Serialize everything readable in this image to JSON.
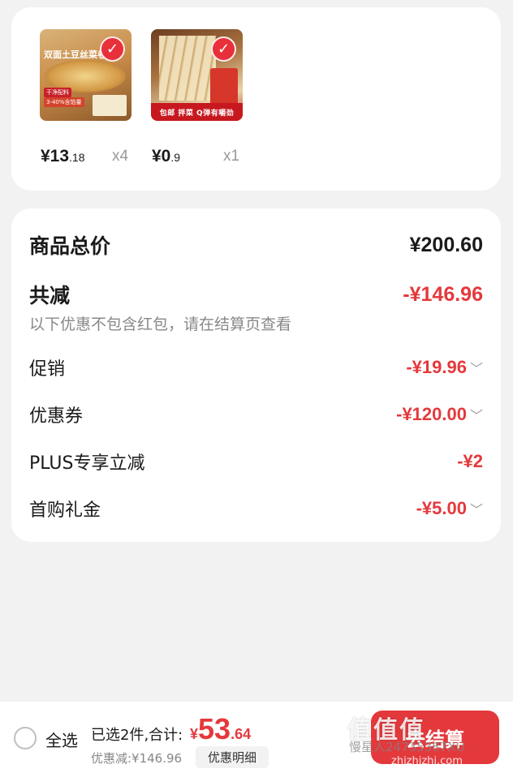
{
  "items": [
    {
      "image_title": "双面土豆丝菜卷",
      "image_tag1": "干净配料",
      "image_tag2": "3-40%含馅量",
      "price_int": "¥13",
      "price_dec": ".18",
      "qty": "x4",
      "checked": true
    },
    {
      "image_banner": "包邮 拌菜 Q弹有嚼劲",
      "price_int": "¥0",
      "price_dec": ".9",
      "qty": "x1",
      "checked": true
    }
  ],
  "summary": {
    "total_label": "商品总价",
    "total_value": "¥200.60",
    "discount_label": "共减",
    "discount_value": "-¥146.96",
    "note": "以下优惠不包含红包，请在结算页查看",
    "rows": [
      {
        "label": "促销",
        "value": "-¥19.96",
        "chevron": "﹀"
      },
      {
        "label": "优惠券",
        "value": "-¥120.00",
        "chevron": "﹀"
      },
      {
        "label": "PLUS专享立减",
        "value": "-¥2",
        "chevron": ""
      },
      {
        "label": "首购礼金",
        "value": "-¥5.00",
        "chevron": "﹀"
      }
    ]
  },
  "bottom": {
    "select_all": "全选",
    "selected_text": "已选2件,合计:",
    "total_symbol": "¥",
    "total_int": "53",
    "total_dec": ".64",
    "saved_text": "优惠减:¥146.96",
    "detail_button": "优惠明细",
    "checkout_button": "去结算",
    "watermark": "值值值",
    "watermark_user": "慢星人24735387XU",
    "watermark_site": "zhizhizhi.com"
  },
  "colors": {
    "accent": "#e4393c",
    "background": "#f2f2f2",
    "card": "#ffffff"
  }
}
